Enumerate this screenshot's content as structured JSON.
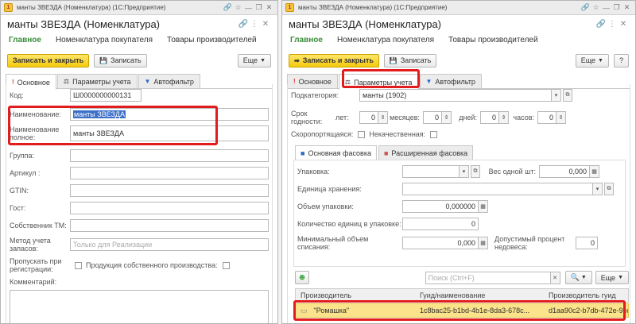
{
  "left": {
    "window_title": "манты ЗВЕЗДА (Номенклатура)  (1С:Предприятие)",
    "header_title": "манты ЗВЕЗДА (Номенклатура)",
    "nav": [
      "Главное",
      "Номенклатура покупателя",
      "Товары производителей"
    ],
    "save_close": "Записать и закрыть",
    "save": "Записать",
    "more": "Еще",
    "help": "?",
    "tabs": [
      "Основное",
      "Параметры учета",
      "Автофильтр"
    ],
    "fields": {
      "code_label": "Код:",
      "code_value": "Ш0000000000131",
      "name_label": "Наименование:",
      "name_value": "манты ЗВЕЗДА",
      "fullname_label": "Наименование полное:",
      "fullname_value": "манты ЗВЕЗДА",
      "group_label": "Группа:",
      "article_label": "Артикул :",
      "gtin_label": "GTIN:",
      "gost_label": "Гост:",
      "owner_label": "Собственник ТМ:",
      "method_label": "Метод учета запасов:",
      "method_placeholder": "Только для Реализации",
      "skip_label": "Пропускать при регистрации:",
      "own_label": "Продукция собственного производства:",
      "comment_label": "Комментарий:"
    }
  },
  "right": {
    "window_title": "манты ЗВЕЗДА (Номенклатура)  (1С:Предприятие)",
    "header_title": "манты ЗВЕЗДА (Номенклатура)",
    "nav": [
      "Главное",
      "Номенклатура покупателя",
      "Товары производителей"
    ],
    "save_close": "Записать и закрыть",
    "save": "Записать",
    "more": "Еще",
    "help": "?",
    "tabs": [
      "Основное",
      "Параметры учета",
      "Автофильтр"
    ],
    "fields": {
      "subcat_label": "Подкатегория:",
      "subcat_value": "манты (1902)",
      "shelf_label": "Срок годности:",
      "years_label": "лет:",
      "years_value": "0",
      "months_label": "месяцев:",
      "months_value": "0",
      "days_label": "дней:",
      "days_value": "0",
      "hours_label": "часов:",
      "hours_value": "0",
      "perishable_label": "Скоропортящаяся:",
      "lowquality_label": "Некачественная:"
    },
    "pack_tabs": [
      "Основная фасовка",
      "Расширенная фасовка"
    ],
    "pack": {
      "pack_label": "Упаковка:",
      "weight_label": "Вес одной шт:",
      "weight_value": "0,000",
      "unit_label": "Единица хранения:",
      "volume_label": "Объем упаковки:",
      "volume_value": "0,000000",
      "count_label": "Количество единиц в упаковке:",
      "count_value": "0",
      "minvol_label": "Минимальный объем списания:",
      "minvol_value": "0,000",
      "shortage_label": "Допустимый процент недовеса:",
      "shortage_value": "0"
    },
    "search_placeholder": "Поиск (Ctrl+F)",
    "more2": "Еще",
    "table": {
      "headers": [
        "Производитель",
        "Гуид/наименование",
        "Производитель гуид"
      ],
      "row": [
        "\"Ромашка\"",
        "1c8bac25-b1bd-4b1e-8da3-678c...",
        "d1aa90c2-b7db-472e-9ce..."
      ]
    }
  }
}
